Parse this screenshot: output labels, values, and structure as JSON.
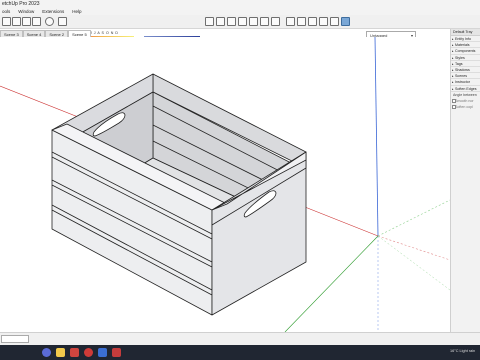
{
  "window": {
    "title": "etchUp Pro 2023"
  },
  "menu": [
    "ools",
    "Window",
    "Extensions",
    "Help"
  ],
  "shadows": {
    "months": "J F M A M J J A S O N D",
    "time_start": "06:43 AM",
    "time_mid": "Noon",
    "time_end": "04:45 PM"
  },
  "tag_select": {
    "value": "Untagged"
  },
  "scene_tabs": [
    "Scene 3",
    "Scene 4",
    "Scene 2",
    "Scene 5"
  ],
  "tray": {
    "title": "Default Tray",
    "items": [
      "Entity Info",
      "Materials",
      "Components",
      "Styles",
      "Tags",
      "Shadows",
      "Scenes",
      "Instructor",
      "Soften Edges"
    ],
    "angle_label": "Angle between",
    "checks": [
      "Smooth nor",
      "Soften copl"
    ]
  },
  "taskbar": {
    "tray_text": "16°C  Light rain"
  },
  "colors": {
    "accent": "#2c6fb7",
    "toolbar": "#f0f0f0",
    "taskbar": "#202632"
  },
  "icons": [
    "orbit-icon",
    "eraser-icon",
    "undo-icon",
    "redo-icon",
    "info-icon",
    "shadows-icon",
    "iso-view-icon",
    "top-view-icon",
    "front-view-icon",
    "right-view-icon",
    "back-view-icon",
    "left-view-icon",
    "bottom-view-icon",
    "xray-icon",
    "wireframe-icon",
    "hidden-line-icon",
    "shaded-icon",
    "textures-icon",
    "monochrome-icon"
  ]
}
